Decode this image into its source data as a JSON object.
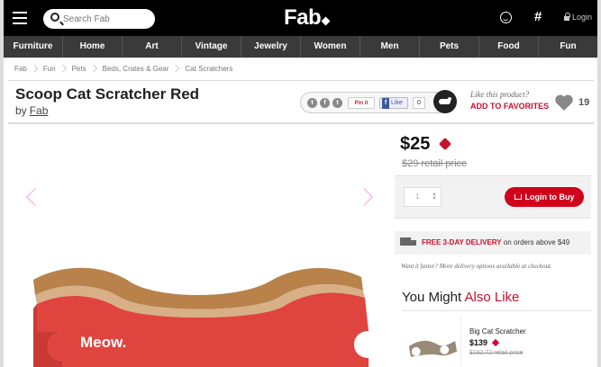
{
  "header": {
    "search_placeholder": "Search Fab",
    "logo": "Fab",
    "hash": "#",
    "login": "Login"
  },
  "nav": [
    {
      "label": "Furniture"
    },
    {
      "label": "Home"
    },
    {
      "label": "Art"
    },
    {
      "label": "Vintage"
    },
    {
      "label": "Jewelry"
    },
    {
      "label": "Women"
    },
    {
      "label": "Men"
    },
    {
      "label": "Pets"
    },
    {
      "label": "Food"
    },
    {
      "label": "Fun"
    }
  ],
  "breadcrumb": [
    "Fab",
    "Fun",
    "Pets",
    "Beds, Crates & Gear",
    "Cat Scratchers"
  ],
  "product": {
    "title": "Scoop Cat Scratcher Red",
    "by": "by",
    "brand": "Fab",
    "image_text": "Meow.",
    "price": "$25",
    "retail_price": "$29 retail price",
    "quantity": "1",
    "buy_label": "Login to Buy"
  },
  "share": {
    "pinit": "Pin it",
    "fb_like": "Like",
    "fb_count": "0"
  },
  "favorites": {
    "question": "Like this product?",
    "add_label": "ADD TO FAVORITES",
    "count": "19"
  },
  "delivery": {
    "highlight": "FREE 3-DAY DELIVERY",
    "rest": " on orders above $49",
    "faster": "Want it faster? More delivery options available at checkout."
  },
  "recommendations": {
    "heading_a": "You Might ",
    "heading_b": "Also Like",
    "items": [
      {
        "name": "Big Cat Scratcher",
        "price": "$139",
        "retail": "$192.72 retail price"
      }
    ]
  },
  "colors": {
    "brand_red": "#c8102e",
    "nav_bg": "#3a3a3a",
    "topbar_bg": "#000000",
    "product_red": "#e0443e",
    "cardboard": "#b8824a"
  }
}
